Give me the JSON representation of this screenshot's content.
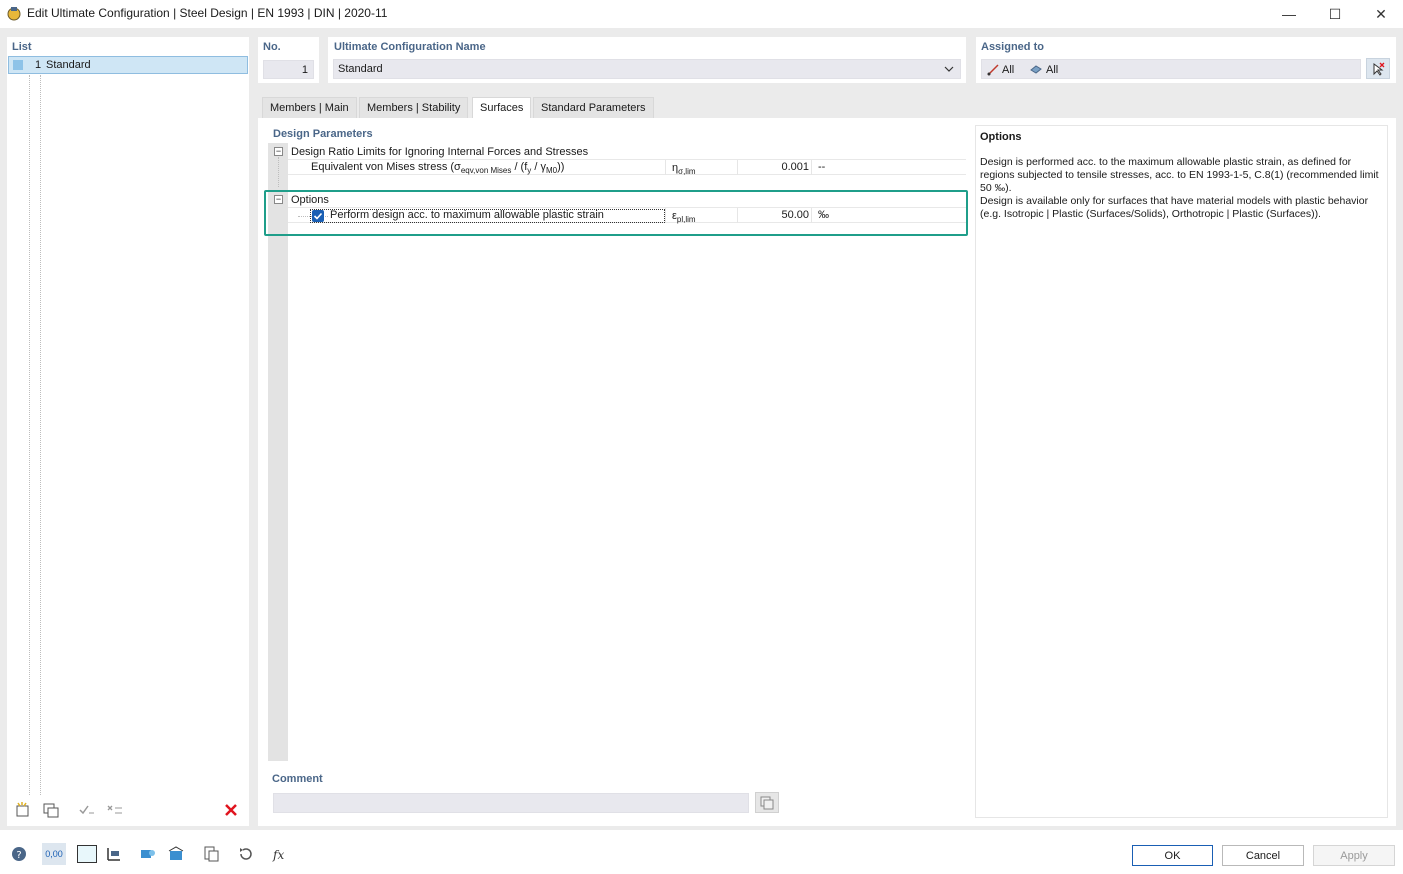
{
  "window": {
    "title": "Edit Ultimate Configuration | Steel Design | EN 1993 | DIN | 2020-11",
    "controls": [
      "—",
      "☐",
      "✕"
    ]
  },
  "list": {
    "header": "List",
    "items": [
      {
        "no": "1",
        "name": "Standard"
      }
    ]
  },
  "no": {
    "header": "No.",
    "value": "1"
  },
  "config_name": {
    "header": "Ultimate Configuration Name",
    "value": "Standard"
  },
  "assigned": {
    "header": "Assigned to",
    "members": "All",
    "surfaces": "All"
  },
  "tabs": [
    {
      "label": "Members | Main",
      "active": false
    },
    {
      "label": "Members | Stability",
      "active": false
    },
    {
      "label": "Surfaces",
      "active": true
    },
    {
      "label": "Standard Parameters",
      "active": false
    }
  ],
  "design_params": {
    "header": "Design Parameters",
    "group1": {
      "label": "Design Ratio Limits for Ignoring Internal Forces and Stresses",
      "row": {
        "label_main": "Equivalent von Mises stress (σ",
        "label_sub1": "eqv,von Mises",
        "label_mid": " / (f",
        "label_sub2": "y",
        "label_mid2": " / γ",
        "label_sub3": "M0",
        "label_end": "))",
        "symbol": "η",
        "symbol_sub": "σ,lim",
        "value": "0.001",
        "unit": "--"
      }
    },
    "group2": {
      "label": "Options",
      "row": {
        "label": "Perform design acc. to maximum allowable plastic strain",
        "checked": true,
        "symbol": "ε",
        "symbol_sub": "pl,lim",
        "value": "50.00",
        "unit": "‰"
      }
    }
  },
  "info": {
    "title": "Options",
    "line1": "Design is performed acc. to the maximum allowable plastic strain, as defined for regions subjected to tensile stresses, acc. to EN 1993-1-5, C.8(1) (recommended limit 50 ‰).",
    "line2": "Design is available only for surfaces that have material models with plastic behavior (e.g. Isotropic | Plastic (Surfaces/Solids), Orthotropic | Plastic (Surfaces))."
  },
  "comment": {
    "header": "Comment",
    "value": ""
  },
  "buttons": {
    "ok": "OK",
    "cancel": "Cancel",
    "apply": "Apply"
  },
  "bottom_toolbar": {
    "decimals_label": "0,00"
  },
  "colors": {
    "highlight": "#1f9e8a",
    "header_text": "#4a6688",
    "checkbox": "#1a5fb4",
    "delete": "#e0141e"
  }
}
